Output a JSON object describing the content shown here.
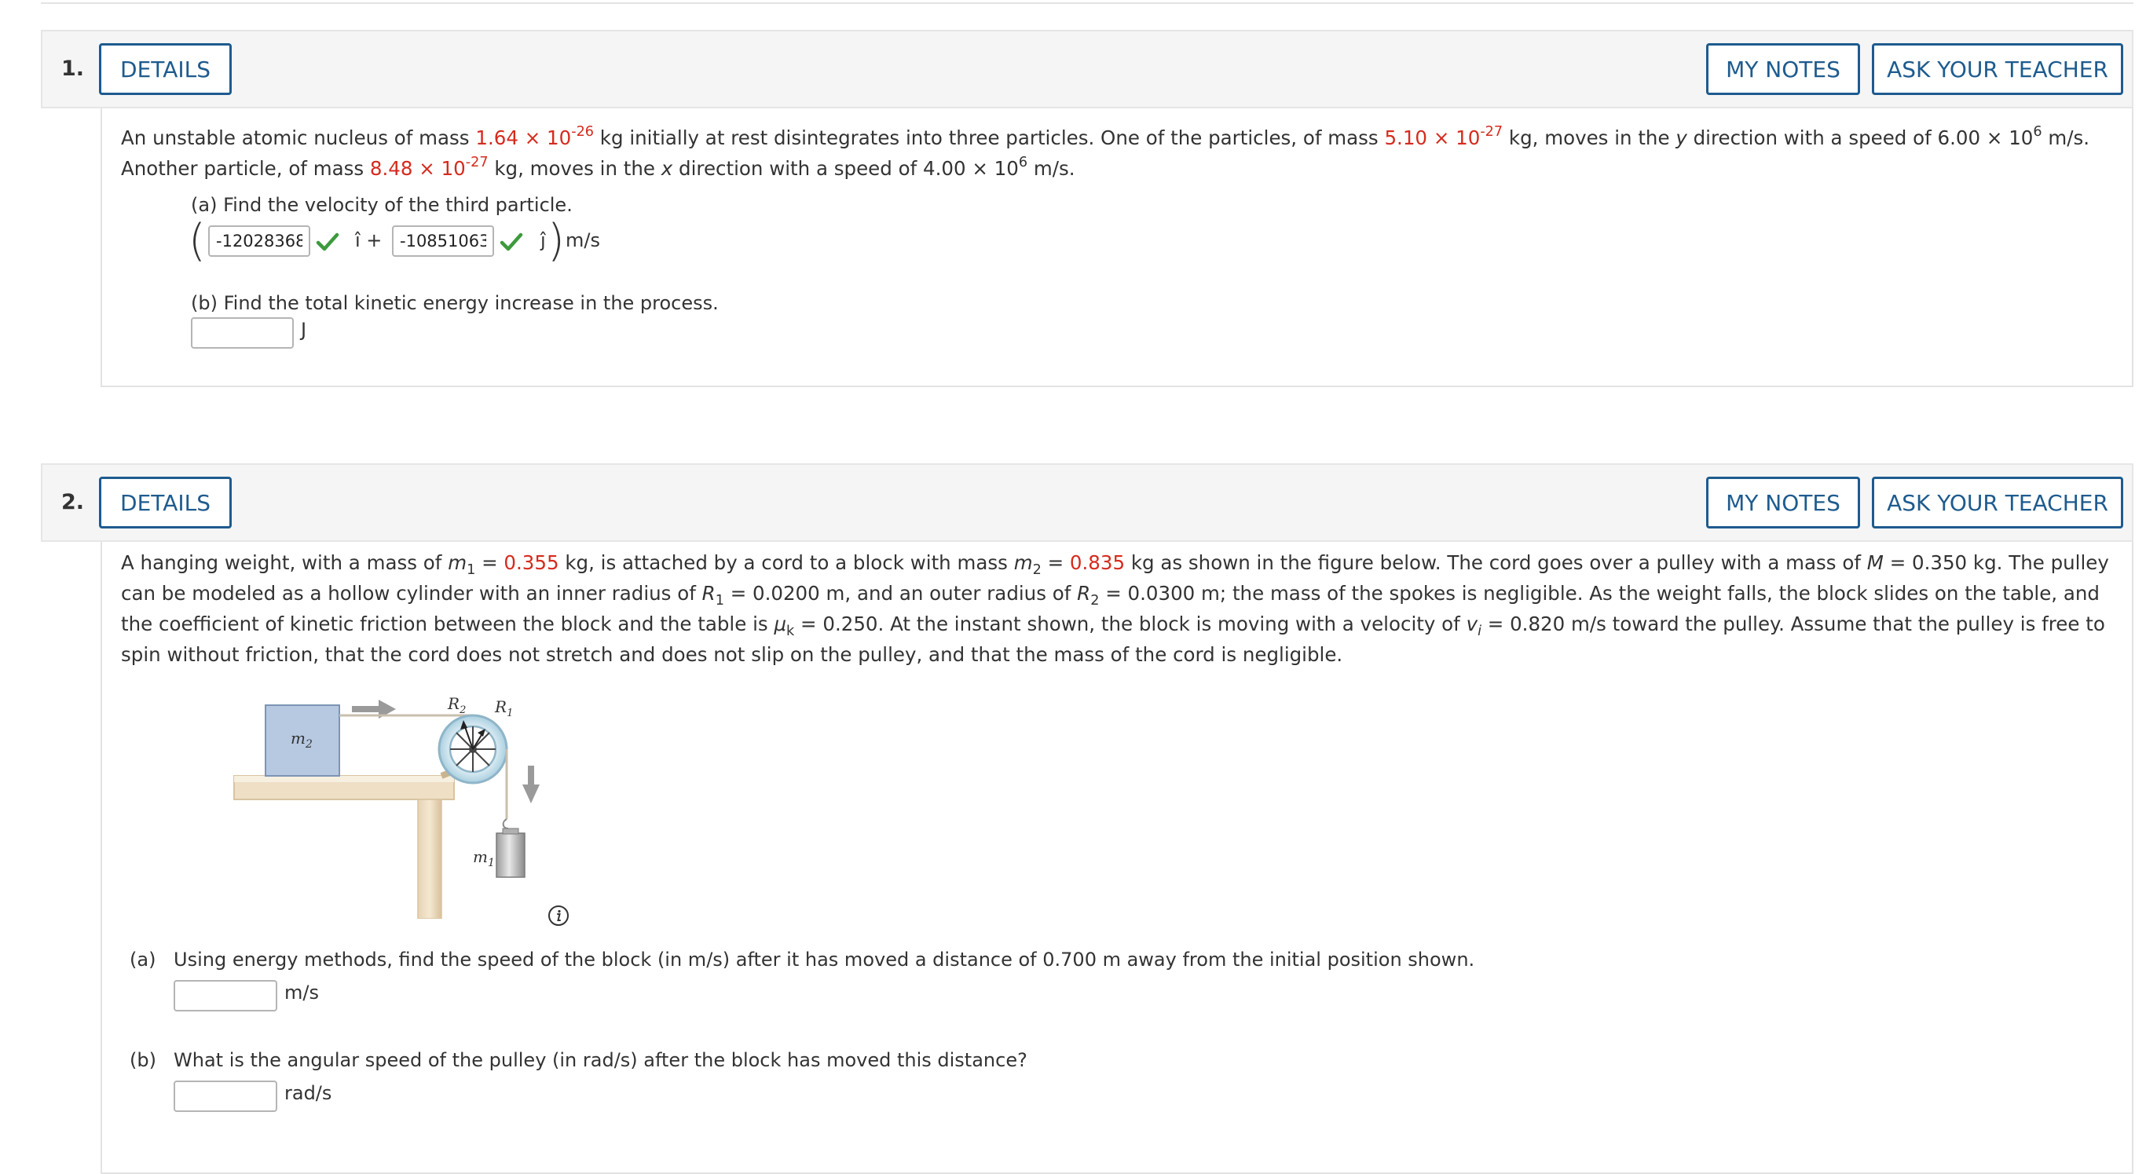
{
  "q1": {
    "number": "1.",
    "details": "DETAILS",
    "my_notes": "MY NOTES",
    "ask_teacher": "ASK YOUR TEACHER",
    "text": {
      "t1": "An unstable atomic nucleus of mass ",
      "m_total_mant": "1.64 ",
      "m_total_times": "× 10",
      "m_total_exp": "-26",
      "t2": " kg initially at rest disintegrates into three particles. One of the particles, of mass ",
      "m1_mant": "5.10 ",
      "m1_times": "× 10",
      "m1_exp": "-27",
      "t3": " kg, moves in the ",
      "y_var": "y",
      "t4": " direction with a speed of 6.00 ",
      "v1_times": "× 10",
      "v1_exp": "6",
      "t5": " m/s. Another particle, of mass ",
      "m2_mant": "8.48 ",
      "m2_times": "× 10",
      "m2_exp": "-27",
      "t6": " kg, moves in the ",
      "x_var": "x",
      "t7": " direction with a speed of 4.00 ",
      "v2_times": "× 10",
      "v2_exp": "6",
      "t8": " m/s."
    },
    "part_a": {
      "label": "(a) Find the velocity of the third particle.",
      "i_value": "-12028368",
      "j_value": "-10851063",
      "i_hat": "î +",
      "j_hat": "ĵ",
      "unit": "m/s"
    },
    "part_b": {
      "label": "(b) Find the total kinetic energy increase in the process.",
      "value": "",
      "unit": "J"
    }
  },
  "q2": {
    "number": "2.",
    "details": "DETAILS",
    "my_notes": "MY NOTES",
    "ask_teacher": "ASK YOUR TEACHER",
    "text": {
      "t1": "A hanging weight, with a mass of ",
      "m1_sym": "m",
      "m1_sub": "1",
      "eq": " = ",
      "m1_val": "0.355",
      "t2": " kg, is attached by a cord to a block with mass ",
      "m2_sym": "m",
      "m2_sub": "2",
      "m2_val": "0.835",
      "t3": " kg as shown in the figure below. The cord goes over a pulley with a mass of ",
      "M_sym": "M",
      "t4": " = 0.350 kg. The pulley can be modeled as a hollow cylinder with an inner radius of ",
      "R_sym": "R",
      "R1_sub": "1",
      "t5": " = 0.0200 m, and an outer radius of ",
      "R2_sub": "2",
      "t6": " = 0.0300 m; the mass of the spokes is negligible. As the weight falls, the block slides on the table, and the coefficient of kinetic friction between the block and the table is ",
      "mu_sym": "μ",
      "mu_sub": "k",
      "t7": " = 0.250. At the instant shown, the block is moving with a velocity of ",
      "v_sym": "v",
      "v_sub": "i",
      "t8": " = 0.820 m/s toward the pulley. Assume that the pulley is free to spin without friction, that the cord does not stretch and does not slip on the pulley, and that the mass of the cord is negligible."
    },
    "figure": {
      "label_m2": "m",
      "label_m2_sub": "2",
      "label_m1": "m",
      "label_m1_sub": "1",
      "label_R2": "R",
      "label_R2_sub": "2",
      "label_R1": "R",
      "label_R1_sub": "1"
    },
    "part_a": {
      "label_prefix": "(a)",
      "label": "Using energy methods, find the speed of the block (in m/s) after it has moved a distance of 0.700 m away from the initial position shown.",
      "value": "",
      "unit": "m/s"
    },
    "part_b": {
      "label_prefix": "(b)",
      "label": "What is the angular speed of the pulley (in rad/s) after the block has moved this distance?",
      "value": "",
      "unit": "rad/s"
    }
  },
  "colors": {
    "accent": "#1e5b8e",
    "highlight_red": "#d52b1e",
    "check_green": "#3d9a3d"
  }
}
